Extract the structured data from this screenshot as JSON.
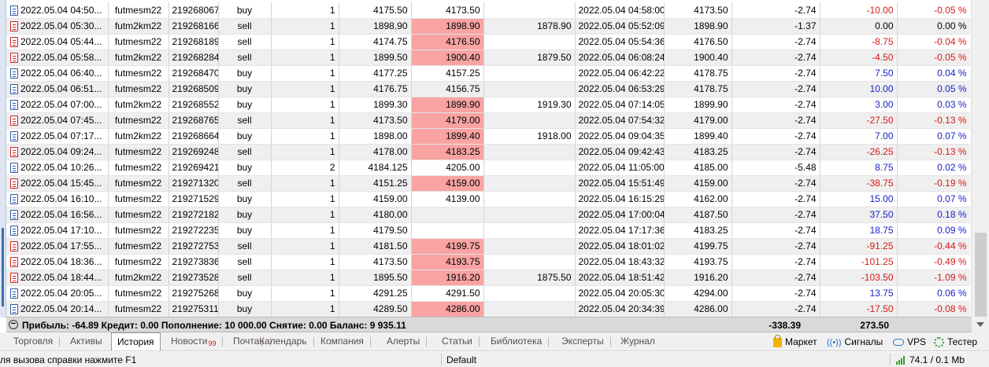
{
  "rows": [
    {
      "time": "2022.05.04 04:50...",
      "symbol": "futmesm22",
      "ticket": "219268067",
      "type": "buy",
      "volume": "1",
      "price": "4175.50",
      "sl": "4173.50",
      "tp": "",
      "close_time": "2022.05.04 04:58:00",
      "close_price": "4173.50",
      "commission": "-2.74",
      "swap": "-10.00",
      "profit": "-0.05 %",
      "sl_hl": false,
      "swap_color": "red",
      "profit_color": "red"
    },
    {
      "time": "2022.05.04 05:30...",
      "symbol": "futm2km22",
      "ticket": "219268166",
      "type": "sell",
      "volume": "1",
      "price": "1898.90",
      "sl": "1898.90",
      "tp": "1878.90",
      "close_time": "2022.05.04 05:52:09",
      "close_price": "1898.90",
      "commission": "-1.37",
      "swap": "0.00",
      "profit": "0.00 %",
      "sl_hl": true,
      "swap_color": "black",
      "profit_color": "black"
    },
    {
      "time": "2022.05.04 05:44...",
      "symbol": "futmesm22",
      "ticket": "219268189",
      "type": "sell",
      "volume": "1",
      "price": "4174.75",
      "sl": "4176.50",
      "tp": "",
      "close_time": "2022.05.04 05:54:36",
      "close_price": "4176.50",
      "commission": "-2.74",
      "swap": "-8.75",
      "profit": "-0.04 %",
      "sl_hl": true,
      "swap_color": "red",
      "profit_color": "red"
    },
    {
      "time": "2022.05.04 05:58...",
      "symbol": "futm2km22",
      "ticket": "219268284",
      "type": "sell",
      "volume": "1",
      "price": "1899.50",
      "sl": "1900.40",
      "tp": "1879.50",
      "close_time": "2022.05.04 06:08:24",
      "close_price": "1900.40",
      "commission": "-2.74",
      "swap": "-4.50",
      "profit": "-0.05 %",
      "sl_hl": true,
      "swap_color": "red",
      "profit_color": "red"
    },
    {
      "time": "2022.05.04 06:40...",
      "symbol": "futmesm22",
      "ticket": "219268470",
      "type": "buy",
      "volume": "1",
      "price": "4177.25",
      "sl": "4157.25",
      "tp": "",
      "close_time": "2022.05.04 06:42:22",
      "close_price": "4178.75",
      "commission": "-2.74",
      "swap": "7.50",
      "profit": "0.04 %",
      "sl_hl": false,
      "swap_color": "blue",
      "profit_color": "blue"
    },
    {
      "time": "2022.05.04 06:51...",
      "symbol": "futmesm22",
      "ticket": "219268509",
      "type": "buy",
      "volume": "1",
      "price": "4176.75",
      "sl": "4156.75",
      "tp": "",
      "close_time": "2022.05.04 06:53:29",
      "close_price": "4178.75",
      "commission": "-2.74",
      "swap": "10.00",
      "profit": "0.05 %",
      "sl_hl": false,
      "swap_color": "blue",
      "profit_color": "blue"
    },
    {
      "time": "2022.05.04 07:00...",
      "symbol": "futm2km22",
      "ticket": "219268552",
      "type": "buy",
      "volume": "1",
      "price": "1899.30",
      "sl": "1899.90",
      "tp": "1919.30",
      "close_time": "2022.05.04 07:14:05",
      "close_price": "1899.90",
      "commission": "-2.74",
      "swap": "3.00",
      "profit": "0.03 %",
      "sl_hl": true,
      "swap_color": "blue",
      "profit_color": "blue"
    },
    {
      "time": "2022.05.04 07:45...",
      "symbol": "futmesm22",
      "ticket": "219268765",
      "type": "sell",
      "volume": "1",
      "price": "4173.50",
      "sl": "4179.00",
      "tp": "",
      "close_time": "2022.05.04 07:54:32",
      "close_price": "4179.00",
      "commission": "-2.74",
      "swap": "-27.50",
      "profit": "-0.13 %",
      "sl_hl": true,
      "swap_color": "red",
      "profit_color": "red"
    },
    {
      "time": "2022.05.04 07:17...",
      "symbol": "futm2km22",
      "ticket": "219268664",
      "type": "buy",
      "volume": "1",
      "price": "1898.00",
      "sl": "1899.40",
      "tp": "1918.00",
      "close_time": "2022.05.04 09:04:35",
      "close_price": "1899.40",
      "commission": "-2.74",
      "swap": "7.00",
      "profit": "0.07 %",
      "sl_hl": true,
      "swap_color": "blue",
      "profit_color": "blue"
    },
    {
      "time": "2022.05.04 09:24...",
      "symbol": "futmesm22",
      "ticket": "219269248",
      "type": "sell",
      "volume": "1",
      "price": "4178.00",
      "sl": "4183.25",
      "tp": "",
      "close_time": "2022.05.04 09:42:43",
      "close_price": "4183.25",
      "commission": "-2.74",
      "swap": "-26.25",
      "profit": "-0.13 %",
      "sl_hl": true,
      "swap_color": "red",
      "profit_color": "red"
    },
    {
      "time": "2022.05.04 10:26...",
      "symbol": "futmesm22",
      "ticket": "219269421",
      "type": "buy",
      "volume": "2",
      "price": "4184.125",
      "sl": "4205.00",
      "tp": "",
      "close_time": "2022.05.04 11:05:00",
      "close_price": "4185.00",
      "commission": "-5.48",
      "swap": "8.75",
      "profit": "0.02 %",
      "sl_hl": false,
      "swap_color": "blue",
      "profit_color": "blue"
    },
    {
      "time": "2022.05.04 15:45...",
      "symbol": "futmesm22",
      "ticket": "219271320",
      "type": "sell",
      "volume": "1",
      "price": "4151.25",
      "sl": "4159.00",
      "tp": "",
      "close_time": "2022.05.04 15:51:49",
      "close_price": "4159.00",
      "commission": "-2.74",
      "swap": "-38.75",
      "profit": "-0.19 %",
      "sl_hl": true,
      "swap_color": "red",
      "profit_color": "red"
    },
    {
      "time": "2022.05.04 16:10...",
      "symbol": "futmesm22",
      "ticket": "219271529",
      "type": "buy",
      "volume": "1",
      "price": "4159.00",
      "sl": "4139.00",
      "tp": "",
      "close_time": "2022.05.04 16:15:29",
      "close_price": "4162.00",
      "commission": "-2.74",
      "swap": "15.00",
      "profit": "0.07 %",
      "sl_hl": false,
      "swap_color": "blue",
      "profit_color": "blue"
    },
    {
      "time": "2022.05.04 16:56...",
      "symbol": "futmesm22",
      "ticket": "219272182",
      "type": "buy",
      "volume": "1",
      "price": "4180.00",
      "sl": "",
      "tp": "",
      "close_time": "2022.05.04 17:00:04",
      "close_price": "4187.50",
      "commission": "-2.74",
      "swap": "37.50",
      "profit": "0.18 %",
      "sl_hl": false,
      "swap_color": "blue",
      "profit_color": "blue"
    },
    {
      "time": "2022.05.04 17:10...",
      "symbol": "futmesm22",
      "ticket": "219272235",
      "type": "buy",
      "volume": "1",
      "price": "4179.50",
      "sl": "",
      "tp": "",
      "close_time": "2022.05.04 17:17:36",
      "close_price": "4183.25",
      "commission": "-2.74",
      "swap": "18.75",
      "profit": "0.09 %",
      "sl_hl": false,
      "swap_color": "blue",
      "profit_color": "blue"
    },
    {
      "time": "2022.05.04 17:55...",
      "symbol": "futmesm22",
      "ticket": "219272753",
      "type": "sell",
      "volume": "1",
      "price": "4181.50",
      "sl": "4199.75",
      "tp": "",
      "close_time": "2022.05.04 18:01:02",
      "close_price": "4199.75",
      "commission": "-2.74",
      "swap": "-91.25",
      "profit": "-0.44 %",
      "sl_hl": true,
      "swap_color": "red",
      "profit_color": "red"
    },
    {
      "time": "2022.05.04 18:36...",
      "symbol": "futmesm22",
      "ticket": "219273836",
      "type": "sell",
      "volume": "1",
      "price": "4173.50",
      "sl": "4193.75",
      "tp": "",
      "close_time": "2022.05.04 18:43:32",
      "close_price": "4193.75",
      "commission": "-2.74",
      "swap": "-101.25",
      "profit": "-0.49 %",
      "sl_hl": true,
      "swap_color": "red",
      "profit_color": "red"
    },
    {
      "time": "2022.05.04 18:44...",
      "symbol": "futm2km22",
      "ticket": "219273528",
      "type": "sell",
      "volume": "1",
      "price": "1895.50",
      "sl": "1916.20",
      "tp": "1875.50",
      "close_time": "2022.05.04 18:51:42",
      "close_price": "1916.20",
      "commission": "-2.74",
      "swap": "-103.50",
      "profit": "-1.09 %",
      "sl_hl": true,
      "swap_color": "red",
      "profit_color": "red"
    },
    {
      "time": "2022.05.04 20:05...",
      "symbol": "futmesm22",
      "ticket": "219275268",
      "type": "buy",
      "volume": "1",
      "price": "4291.25",
      "sl": "4291.50",
      "tp": "",
      "close_time": "2022.05.04 20:05:30",
      "close_price": "4294.00",
      "commission": "-2.74",
      "swap": "13.75",
      "profit": "0.06 %",
      "sl_hl": false,
      "swap_color": "blue",
      "profit_color": "blue"
    },
    {
      "time": "2022.05.04 20:14...",
      "symbol": "futmesm22",
      "ticket": "219275311",
      "type": "buy",
      "volume": "1",
      "price": "4289.50",
      "sl": "4286.00",
      "tp": "",
      "close_time": "2022.05.04 20:34:39",
      "close_price": "4286.00",
      "commission": "-2.74",
      "swap": "-17.50",
      "profit": "-0.08 %",
      "sl_hl": true,
      "swap_color": "red",
      "profit_color": "red"
    }
  ],
  "summary": {
    "text": "Прибыль: -64.89  Кредит: 0.00  Пополнение: 10 000.00  Снятие: 0.00  Баланс: 9 935.11",
    "commission_total": "-338.39",
    "swap_total": "273.50"
  },
  "tabs": [
    {
      "label": "Торговля",
      "badge": ""
    },
    {
      "label": "Активы",
      "badge": ""
    },
    {
      "label": "История",
      "badge": "",
      "active": true
    },
    {
      "label": "Новости",
      "badge": "99"
    },
    {
      "label": "Почта",
      "badge": "7"
    },
    {
      "label": "Календарь",
      "badge": ""
    },
    {
      "label": "Компания",
      "badge": ""
    },
    {
      "label": "Алерты",
      "badge": ""
    },
    {
      "label": "Статьи",
      "badge": ""
    },
    {
      "label": "Библиотека",
      "badge": ""
    },
    {
      "label": "Эксперты",
      "badge": ""
    },
    {
      "label": "Журнал",
      "badge": ""
    }
  ],
  "right_buttons": {
    "market": "Маркет",
    "signals": "Сигналы",
    "vps": "VPS",
    "tester": "Тестер"
  },
  "status": {
    "help": "ля вызова справки нажмите F1",
    "profile": "Default",
    "traffic": "74.1 / 0.1 Mb"
  },
  "colors": {
    "sl_highlight": "#f9a3a3",
    "positive": "#1a22c8",
    "negative": "#d61a1a",
    "badge": "#d01515"
  }
}
